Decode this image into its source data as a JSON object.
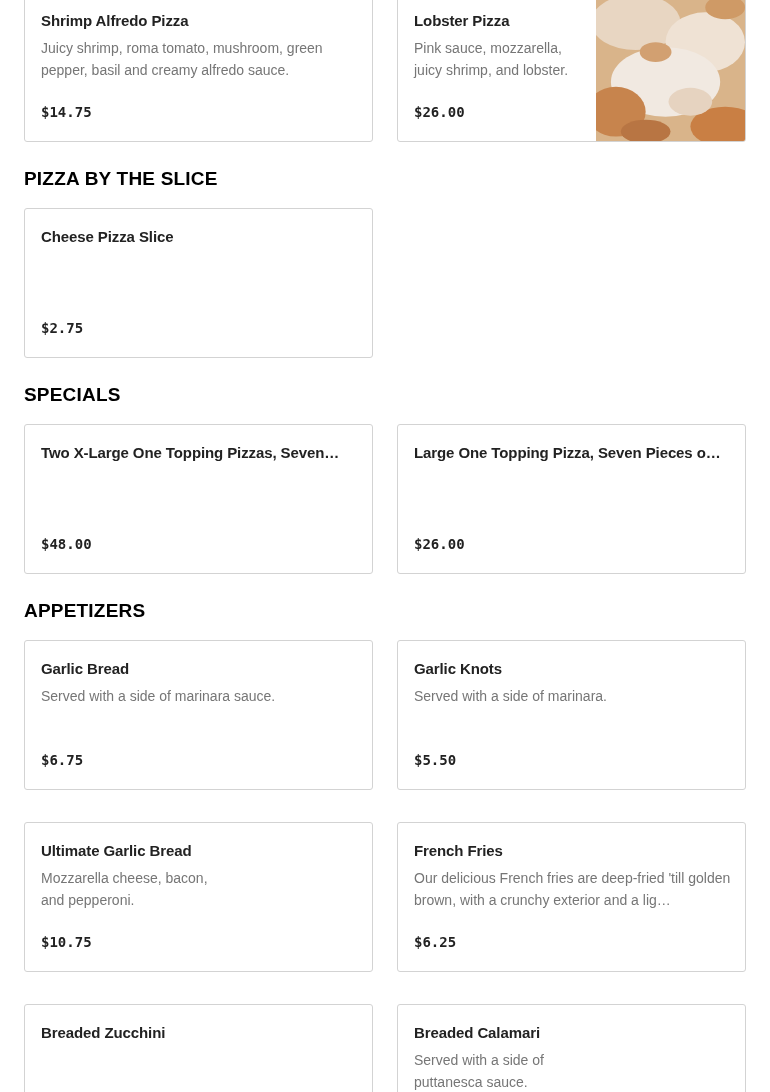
{
  "sections": [
    {
      "items": [
        {
          "name": "Shrimp Alfredo Pizza",
          "description": "Juicy shrimp, roma tomato, mushroom, green pepper, basil and creamy alfredo sauce.",
          "price": "$14.75"
        },
        {
          "name": "Lobster Pizza",
          "description": "Pink sauce, mozzarella,\njuicy shrimp, and lobster.",
          "price": "$26.00"
        }
      ]
    },
    {
      "heading": "PIZZA BY THE SLICE",
      "items": [
        {
          "name": "Cheese Pizza Slice",
          "price": "$2.75"
        }
      ]
    },
    {
      "heading": "SPECIALS",
      "items": [
        {
          "name": "Two X-Large One Topping Pizzas, Seven…",
          "price": "$48.00"
        },
        {
          "name": "Large One Topping Pizza, Seven Pieces o…",
          "price": "$26.00"
        }
      ]
    },
    {
      "heading": "APPETIZERS",
      "items": [
        {
          "name": "Garlic Bread",
          "description": "Served with a side of marinara sauce.",
          "price": "$6.75"
        },
        {
          "name": "Garlic Knots",
          "description": "Served with a side of marinara.",
          "price": "$5.50"
        },
        {
          "name": "Ultimate Garlic Bread",
          "description": "Mozzarella cheese, bacon,\nand pepperoni.",
          "price": "$10.75"
        },
        {
          "name": "French Fries",
          "description": "Our delicious French fries are deep-fried 'till golden brown, with a crunchy exterior and a lig…",
          "price": "$6.25"
        },
        {
          "name": "Breaded Zucchini"
        },
        {
          "name": "Breaded Calamari",
          "description": "Served with a side of\nputtanesca sauce."
        }
      ]
    }
  ]
}
